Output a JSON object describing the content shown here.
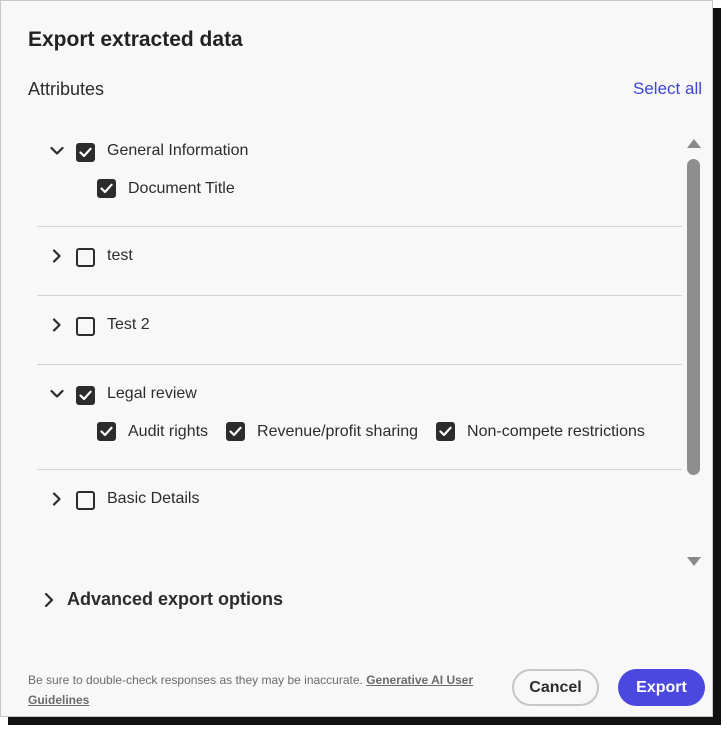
{
  "dialog": {
    "title": "Export extracted data",
    "attributes_label": "Attributes",
    "select_all_label": "Select all"
  },
  "groups": [
    {
      "label": "General Information",
      "expanded": true,
      "checked": true,
      "children": [
        {
          "label": "Document Title",
          "checked": true
        }
      ]
    },
    {
      "label": "test",
      "expanded": false,
      "checked": false,
      "children": []
    },
    {
      "label": "Test 2",
      "expanded": false,
      "checked": false,
      "children": []
    },
    {
      "label": "Legal review",
      "expanded": true,
      "checked": true,
      "children": [
        {
          "label": "Audit rights",
          "checked": true
        },
        {
          "label": "Revenue/profit sharing",
          "checked": true
        },
        {
          "label": "Non-compete restrictions",
          "checked": true
        }
      ]
    },
    {
      "label": "Basic Details",
      "expanded": false,
      "checked": false,
      "children": []
    }
  ],
  "advanced_options_label": "Advanced export options",
  "footer": {
    "disclaimer_text": "Be sure to double-check responses as they may be inaccurate. ",
    "guidelines_link": "Generative AI User Guidelines",
    "cancel_label": "Cancel",
    "export_label": "Export"
  },
  "colors": {
    "accent": "#4b48e0",
    "link": "#3b45d6",
    "checkbox_checked": "#2c2c2c"
  },
  "icons": {
    "expanded": "chevron-down-icon",
    "collapsed": "chevron-right-icon",
    "checked": "checkmark-icon"
  }
}
